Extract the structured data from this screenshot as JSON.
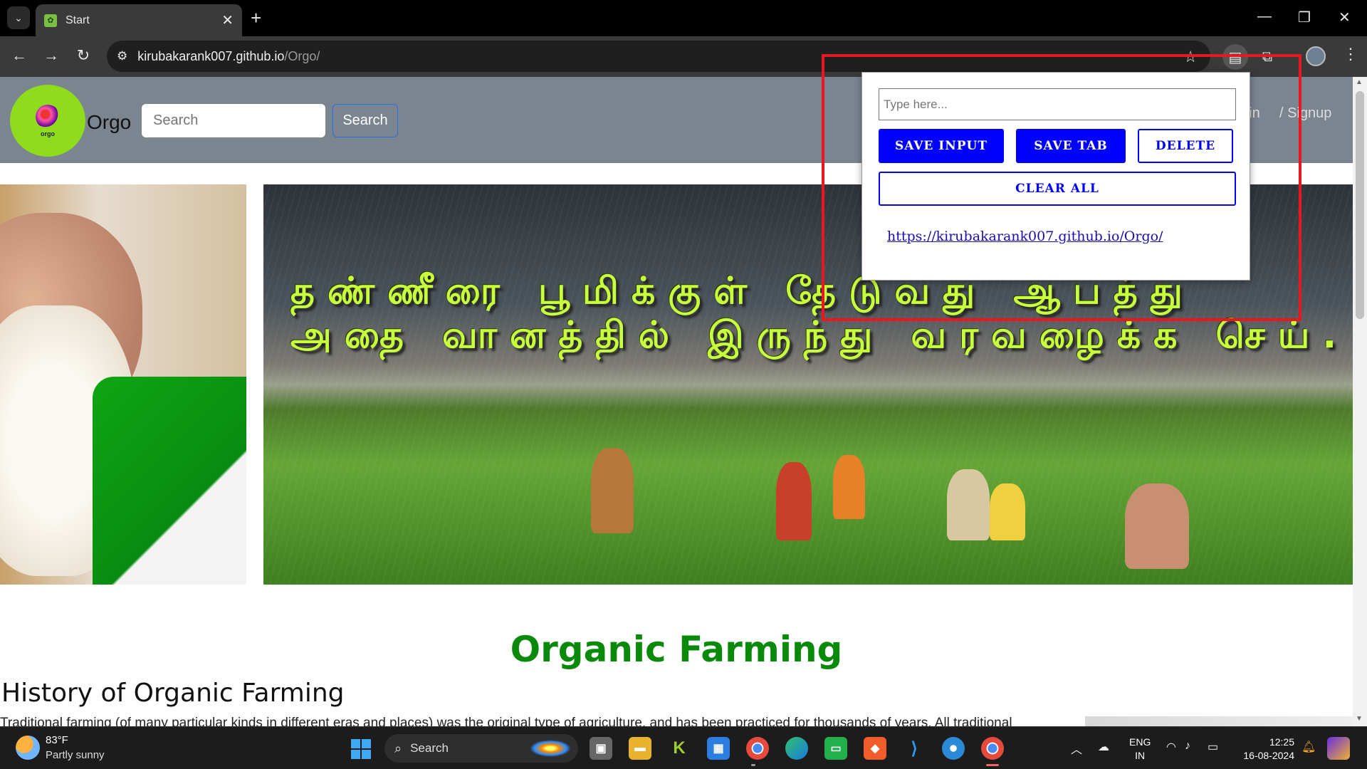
{
  "browser": {
    "tab_title": "Start",
    "tab_close": "✕",
    "new_tab": "+",
    "url_host": "kirubakarank007.github.io",
    "url_path": "/Orgo/",
    "window_controls": {
      "minimize": "—",
      "restore": "❐",
      "close": "✕"
    }
  },
  "site": {
    "logo_text": "orgo",
    "name": "Orgo",
    "search_placeholder": "Search",
    "search_button": "Search",
    "login_link": "gin",
    "signup_link": "/ Signup",
    "hero_line1": "தண்ணீரை பூமிக்குள் தேடுவது ஆபத்து",
    "hero_line2": "அதை வானத்தில் இருந்து வரவழைக்க செய்.",
    "section_title": "Organic Farming",
    "history_title": "History of Organic Farming",
    "history_text": "Traditional farming (of many particular kinds in different eras and places) was the original type of agriculture, and has been practiced for thousands of years. All traditional"
  },
  "popup": {
    "input_placeholder": "Type here...",
    "save_input": "SAVE INPUT",
    "save_tab": "SAVE TAB",
    "delete": "DELETE",
    "clear_all": "CLEAR ALL",
    "saved_links": [
      "https://kirubakarank007.github.io/Orgo/"
    ]
  },
  "taskbar": {
    "weather_temp": "83°F",
    "weather_desc": "Partly sunny",
    "search_label": "Search",
    "lang_line1": "ENG",
    "lang_line2": "IN",
    "time": "12:25",
    "date": "16-08-2024"
  },
  "colors": {
    "popup_button_blue": "#0000ff",
    "highlight_red": "#e81820",
    "section_title_green": "#0a8a0a",
    "header_gray": "#7a8590"
  }
}
